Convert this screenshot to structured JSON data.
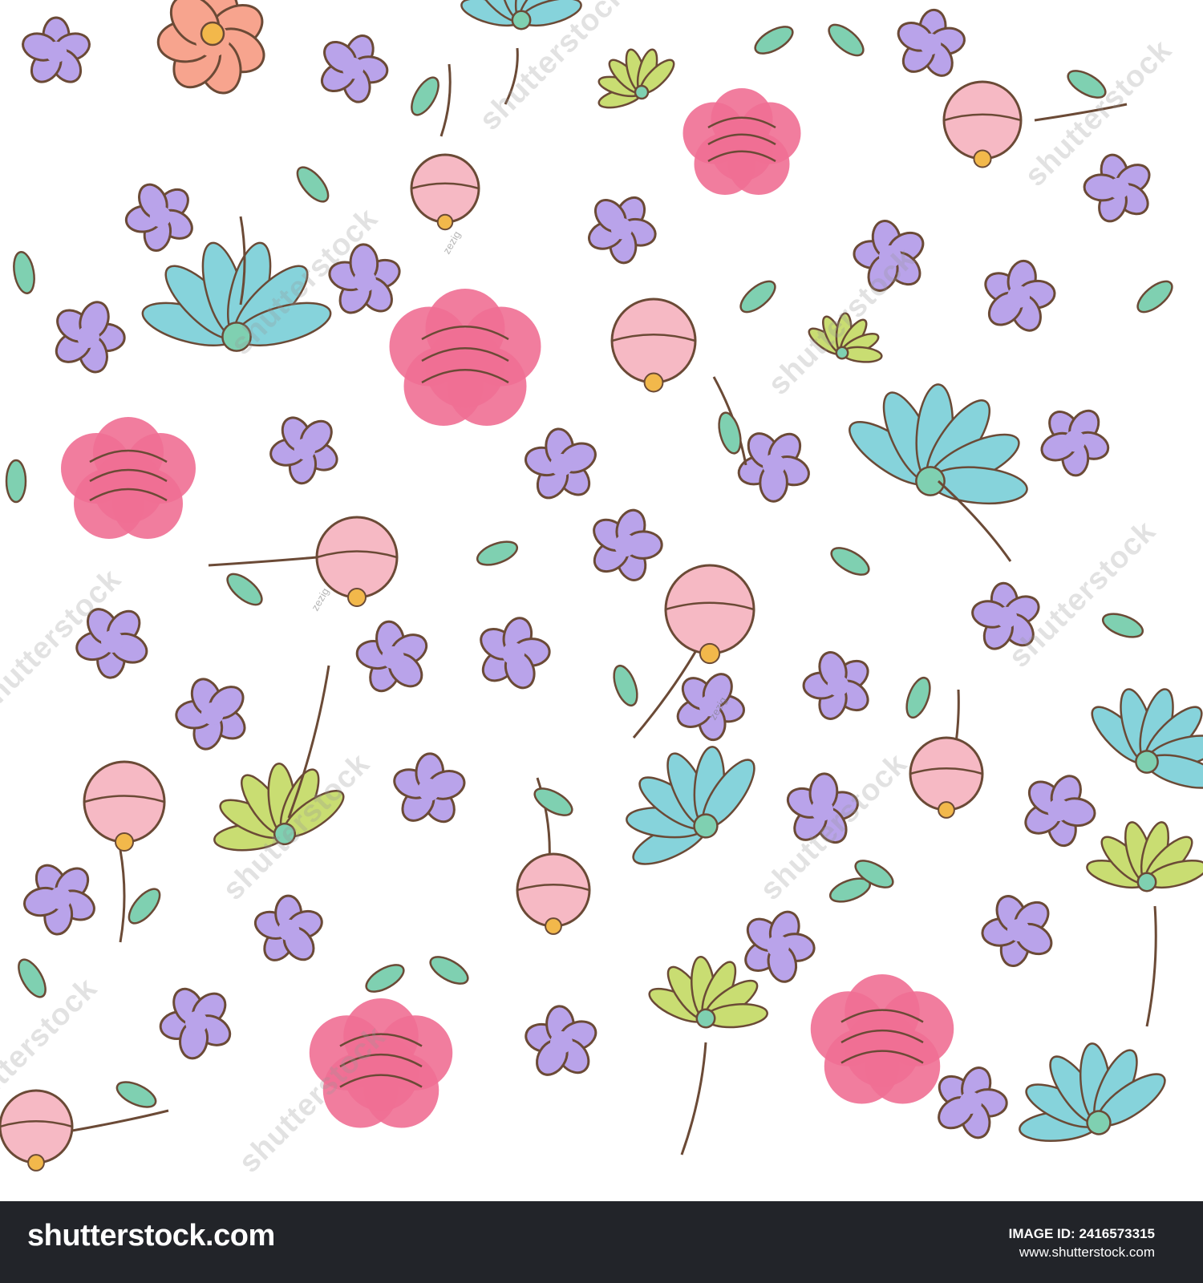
{
  "image": {
    "subject": "Seamless pastel floral pattern",
    "background_color": "#ffffff",
    "palette": {
      "lavender": "#b9a3ea",
      "pink_peony": "#ef6f94",
      "pink_bud": "#f6b9c4",
      "aqua_flower": "#86d3db",
      "leaf": "#7fd0b1",
      "yellow_green": "#c9dd72",
      "coral": "#f7a48e",
      "outline": "#6b4a36",
      "gold": "#f2b84b"
    }
  },
  "watermark": {
    "text": "shutterstock",
    "artist": "zezig"
  },
  "footer": {
    "logo": "shutterstock.com",
    "image_id_line": "IMAGE ID: 2416573315",
    "url": "www.shutterstock.com",
    "background": "#222429"
  }
}
